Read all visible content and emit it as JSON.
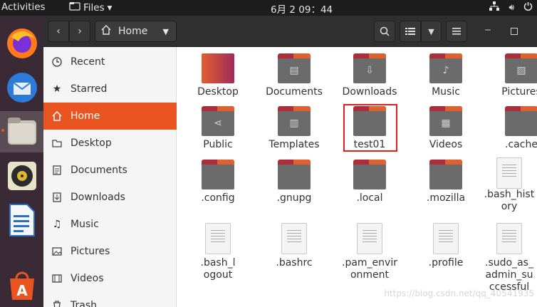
{
  "topbar": {
    "activities": "Activities",
    "app_name": "Files",
    "clock": "6月 2  09：44"
  },
  "dock": {
    "items": [
      {
        "name": "firefox-icon"
      },
      {
        "name": "thunderbird-icon"
      },
      {
        "name": "files-icon",
        "active": true
      },
      {
        "name": "rhythmbox-icon"
      },
      {
        "name": "libreoffice-writer-icon"
      },
      {
        "name": "ubuntu-software-icon"
      }
    ]
  },
  "header": {
    "location": "Home",
    "back_icon": "chevron-left-icon",
    "forward_icon": "chevron-right-icon"
  },
  "sidebar": {
    "items": [
      {
        "label": "Recent",
        "icon": "clock-icon"
      },
      {
        "label": "Starred",
        "icon": "star-icon"
      },
      {
        "label": "Home",
        "icon": "home-icon",
        "active": true
      },
      {
        "label": "Desktop",
        "icon": "folder-icon"
      },
      {
        "label": "Documents",
        "icon": "document-icon"
      },
      {
        "label": "Downloads",
        "icon": "download-icon"
      },
      {
        "label": "Music",
        "icon": "music-icon"
      },
      {
        "label": "Pictures",
        "icon": "picture-icon"
      },
      {
        "label": "Videos",
        "icon": "video-icon"
      },
      {
        "label": "Trash",
        "icon": "trash-icon"
      }
    ]
  },
  "files": {
    "row1": [
      "Desktop",
      "Documents",
      "Downloads",
      "Music",
      "Pictures"
    ],
    "row2": [
      "Public",
      "Templates",
      "test01",
      "Videos",
      ".cache"
    ],
    "row3": [
      ".config",
      ".gnupg",
      ".local",
      ".mozilla",
      ".bash_history"
    ],
    "row4": [
      ".bash_logout",
      ".bashrc",
      ".pam_environment",
      ".profile",
      ".sudo_as_admin_successful"
    ]
  },
  "watermark": "https://blog.csdn.net/qq_40541935"
}
